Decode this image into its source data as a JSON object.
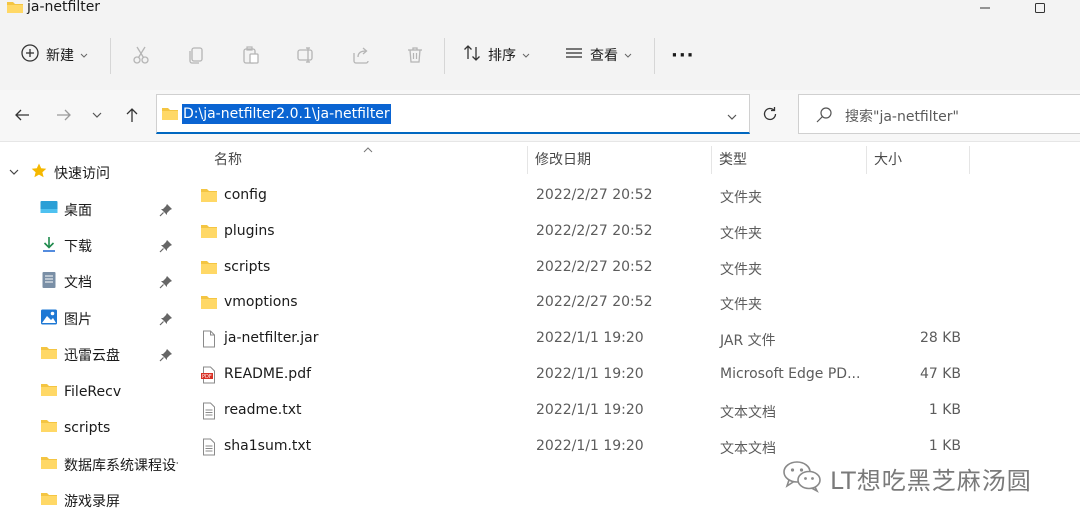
{
  "window": {
    "title": "ja-netfilter"
  },
  "toolbar": {
    "new_label": "新建",
    "sort_label": "排序",
    "view_label": "查看",
    "more_label": "···"
  },
  "address": {
    "path": "D:\\ja-netfilter2.0.1\\ja-netfilter",
    "search_placeholder": "搜索\"ja-netfilter\""
  },
  "sidebar": {
    "quick_access_label": "快速访问",
    "items": [
      {
        "label": "桌面",
        "icon": "desktop-icon",
        "pinned": true
      },
      {
        "label": "下载",
        "icon": "download-icon",
        "pinned": true
      },
      {
        "label": "文档",
        "icon": "document-icon",
        "pinned": true
      },
      {
        "label": "图片",
        "icon": "picture-icon",
        "pinned": true
      },
      {
        "label": "迅雷云盘",
        "icon": "folder-icon",
        "pinned": true
      },
      {
        "label": "FileRecv",
        "icon": "folder-icon",
        "pinned": false
      },
      {
        "label": "scripts",
        "icon": "folder-icon",
        "pinned": false
      },
      {
        "label": "数据库系统课程设计",
        "icon": "folder-icon",
        "pinned": false
      },
      {
        "label": "游戏录屏",
        "icon": "folder-icon",
        "pinned": false
      }
    ]
  },
  "columns": {
    "name": "名称",
    "date": "修改日期",
    "type": "类型",
    "size": "大小"
  },
  "files": [
    {
      "name": "config",
      "date": "2022/2/27 20:52",
      "type": "文件夹",
      "size": "",
      "icon": "folder-icon"
    },
    {
      "name": "plugins",
      "date": "2022/2/27 20:52",
      "type": "文件夹",
      "size": "",
      "icon": "folder-icon"
    },
    {
      "name": "scripts",
      "date": "2022/2/27 20:52",
      "type": "文件夹",
      "size": "",
      "icon": "folder-icon"
    },
    {
      "name": "vmoptions",
      "date": "2022/2/27 20:52",
      "type": "文件夹",
      "size": "",
      "icon": "folder-icon"
    },
    {
      "name": "ja-netfilter.jar",
      "date": "2022/1/1 19:20",
      "type": "JAR 文件",
      "size": "28 KB",
      "icon": "blank-file-icon"
    },
    {
      "name": "README.pdf",
      "date": "2022/1/1 19:20",
      "type": "Microsoft Edge PD...",
      "size": "47 KB",
      "icon": "pdf-file-icon"
    },
    {
      "name": "readme.txt",
      "date": "2022/1/1 19:20",
      "type": "文本文档",
      "size": "1 KB",
      "icon": "text-file-icon"
    },
    {
      "name": "sha1sum.txt",
      "date": "2022/1/1 19:20",
      "type": "文本文档",
      "size": "1 KB",
      "icon": "text-file-icon"
    }
  ],
  "watermark": {
    "text": "LT想吃黑芝麻汤圆"
  },
  "colors": {
    "accent": "#0067c0",
    "selection": "#0a64d2",
    "folder": "#f4c542",
    "chrome_bg": "#f3f3f3"
  }
}
